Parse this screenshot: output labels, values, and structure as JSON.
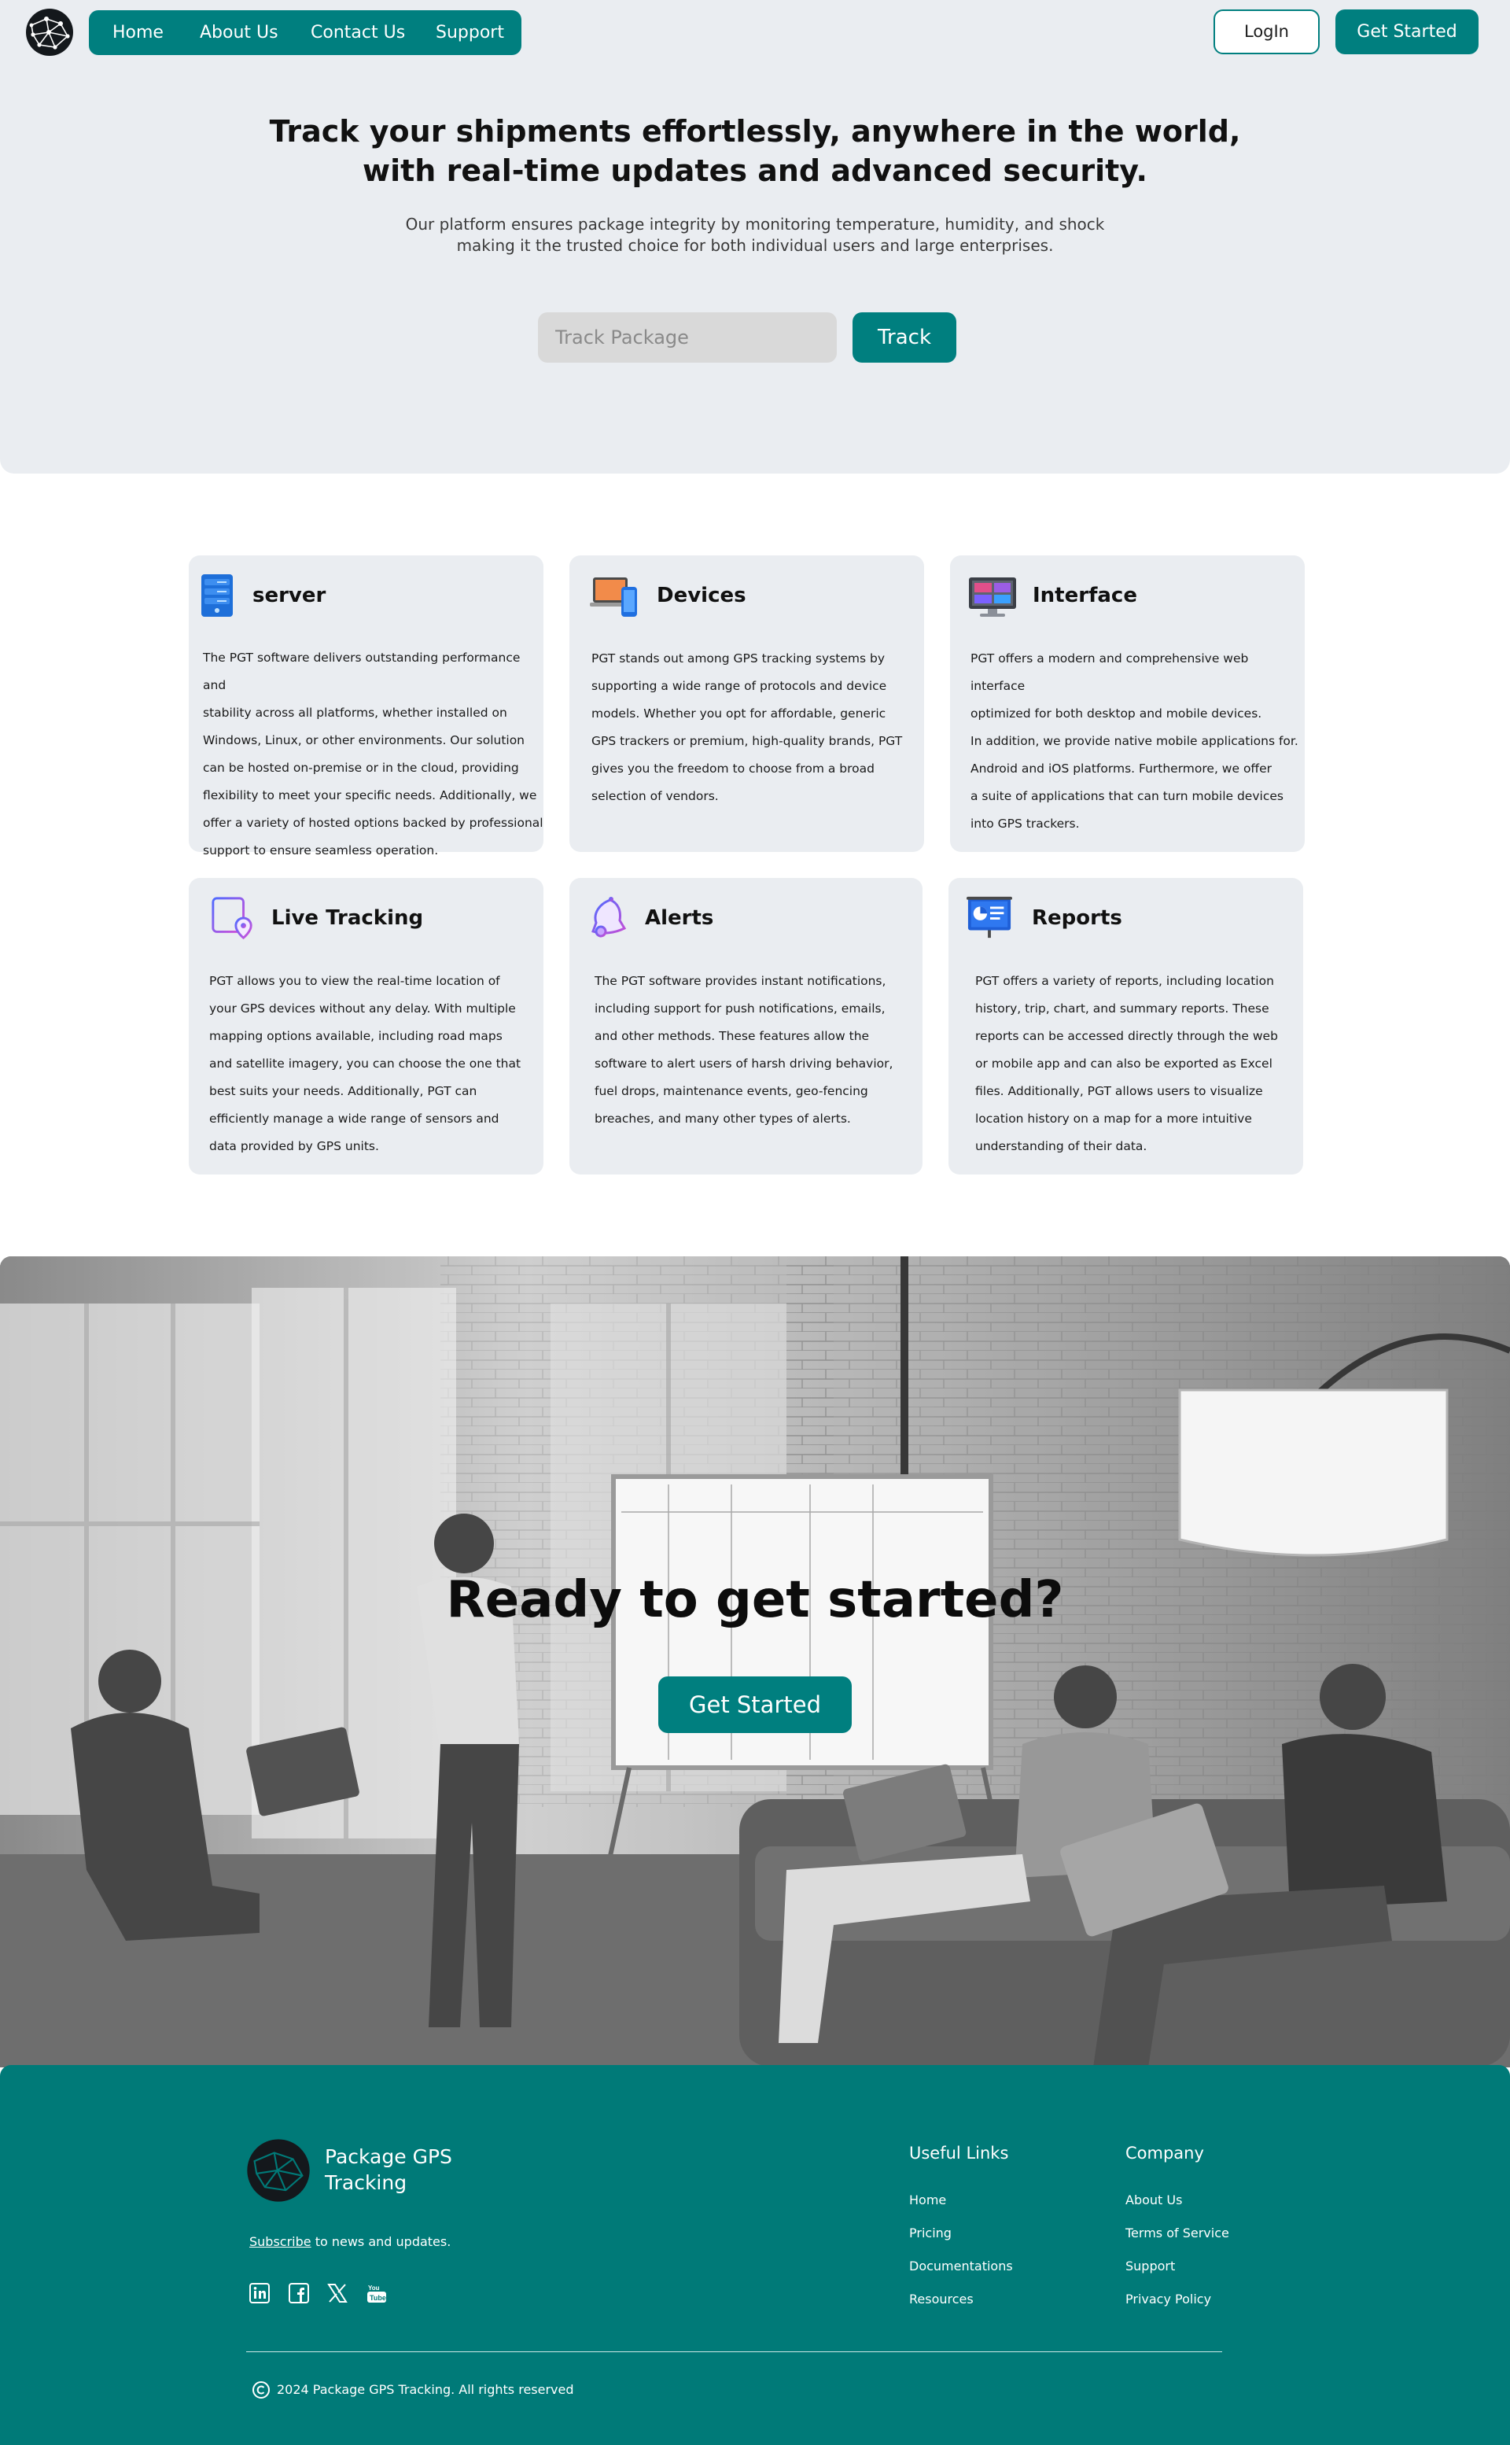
{
  "nav": {
    "items": [
      "Home",
      "About Us",
      "Contact Us",
      "Support"
    ],
    "login_label": "LogIn",
    "get_started_label": "Get Started"
  },
  "hero": {
    "title_line1": "Track your shipments effortlessly, anywhere in the world,",
    "title_line2": "with real-time updates and advanced security.",
    "subtitle_line1": "Our platform ensures package integrity by monitoring temperature, humidity, and shock",
    "subtitle_line2": "making it the trusted choice for both individual users and large enterprises.",
    "track_placeholder": "Track Package",
    "track_button": "Track"
  },
  "features": [
    {
      "title": "server",
      "icon": "server-icon",
      "body": "The PGT software delivers outstanding performance and\nstability across all platforms, whether installed on\nWindows, Linux, or other environments. Our solution\ncan be hosted on-premise or in the cloud, providing\nflexibility to meet your specific needs. Additionally, we\noffer a variety of hosted options backed by professional\nsupport to ensure seamless operation."
    },
    {
      "title": "Devices",
      "icon": "devices-icon",
      "body": "PGT stands out among GPS tracking systems by\n supporting a wide range of protocols and device\n models. Whether you opt for affordable, generic\n GPS trackers or premium, high-quality brands, PGT\n gives you the freedom to choose from a broad\n selection of vendors."
    },
    {
      "title": "Interface",
      "icon": "monitor-icon",
      "body": "PGT offers a modern and comprehensive web interface\n optimized for both desktop and mobile devices.\n In addition, we provide native mobile applications for.\n Android and iOS platforms. Furthermore, we offer\n a suite of applications that can turn mobile devices\n into GPS trackers."
    },
    {
      "title": "Live Tracking",
      "icon": "live-tracking-icon",
      "body": "PGT allows you to view the real-time location of\n your GPS devices without any delay. With multiple\n mapping options available, including road maps\n and satellite imagery, you can choose the one that\n best suits your needs. Additionally, PGT can\n efficiently manage a wide range of sensors and\n data provided by GPS units."
    },
    {
      "title": "Alerts",
      "icon": "bell-icon",
      "body": "The PGT software provides instant notifications,\n including support for push notifications, emails,\n and other methods. These features allow the\n software to alert users of harsh driving behavior,\n fuel drops, maintenance events, geo-fencing\n breaches, and many other types of alerts."
    },
    {
      "title": "Reports",
      "icon": "reports-icon",
      "body": "PGT offers a variety of reports, including location\n history, trip, chart, and summary reports. These\n reports can be accessed directly through the web\n or mobile app and can also be exported as Excel\n files. Additionally, PGT allows users to visualize\n location history on a map for a more intuitive\n understanding of their data."
    }
  ],
  "cta": {
    "title": "Ready to get started?",
    "button": "Get Started"
  },
  "footer": {
    "brand": "Package GPS\nTracking",
    "subscribe_link": "Subscribe",
    "subscribe_rest": " to news and updates.",
    "social": [
      "linkedin-icon",
      "facebook-icon",
      "x-icon",
      "youtube-icon"
    ],
    "useful_links_title": "Useful Links",
    "useful_links": [
      "Home",
      "Pricing",
      "Documentations",
      "Resources"
    ],
    "company_title": "Company",
    "company_links": [
      "About Us",
      "Terms of Service",
      "Support",
      "Privacy Policy"
    ],
    "copyright": "2024 Package GPS Tracking. All rights reserved"
  },
  "colors": {
    "brand_teal": "#007f7f",
    "footer_teal": "#007a78",
    "panel_gray": "#eaedf1"
  }
}
